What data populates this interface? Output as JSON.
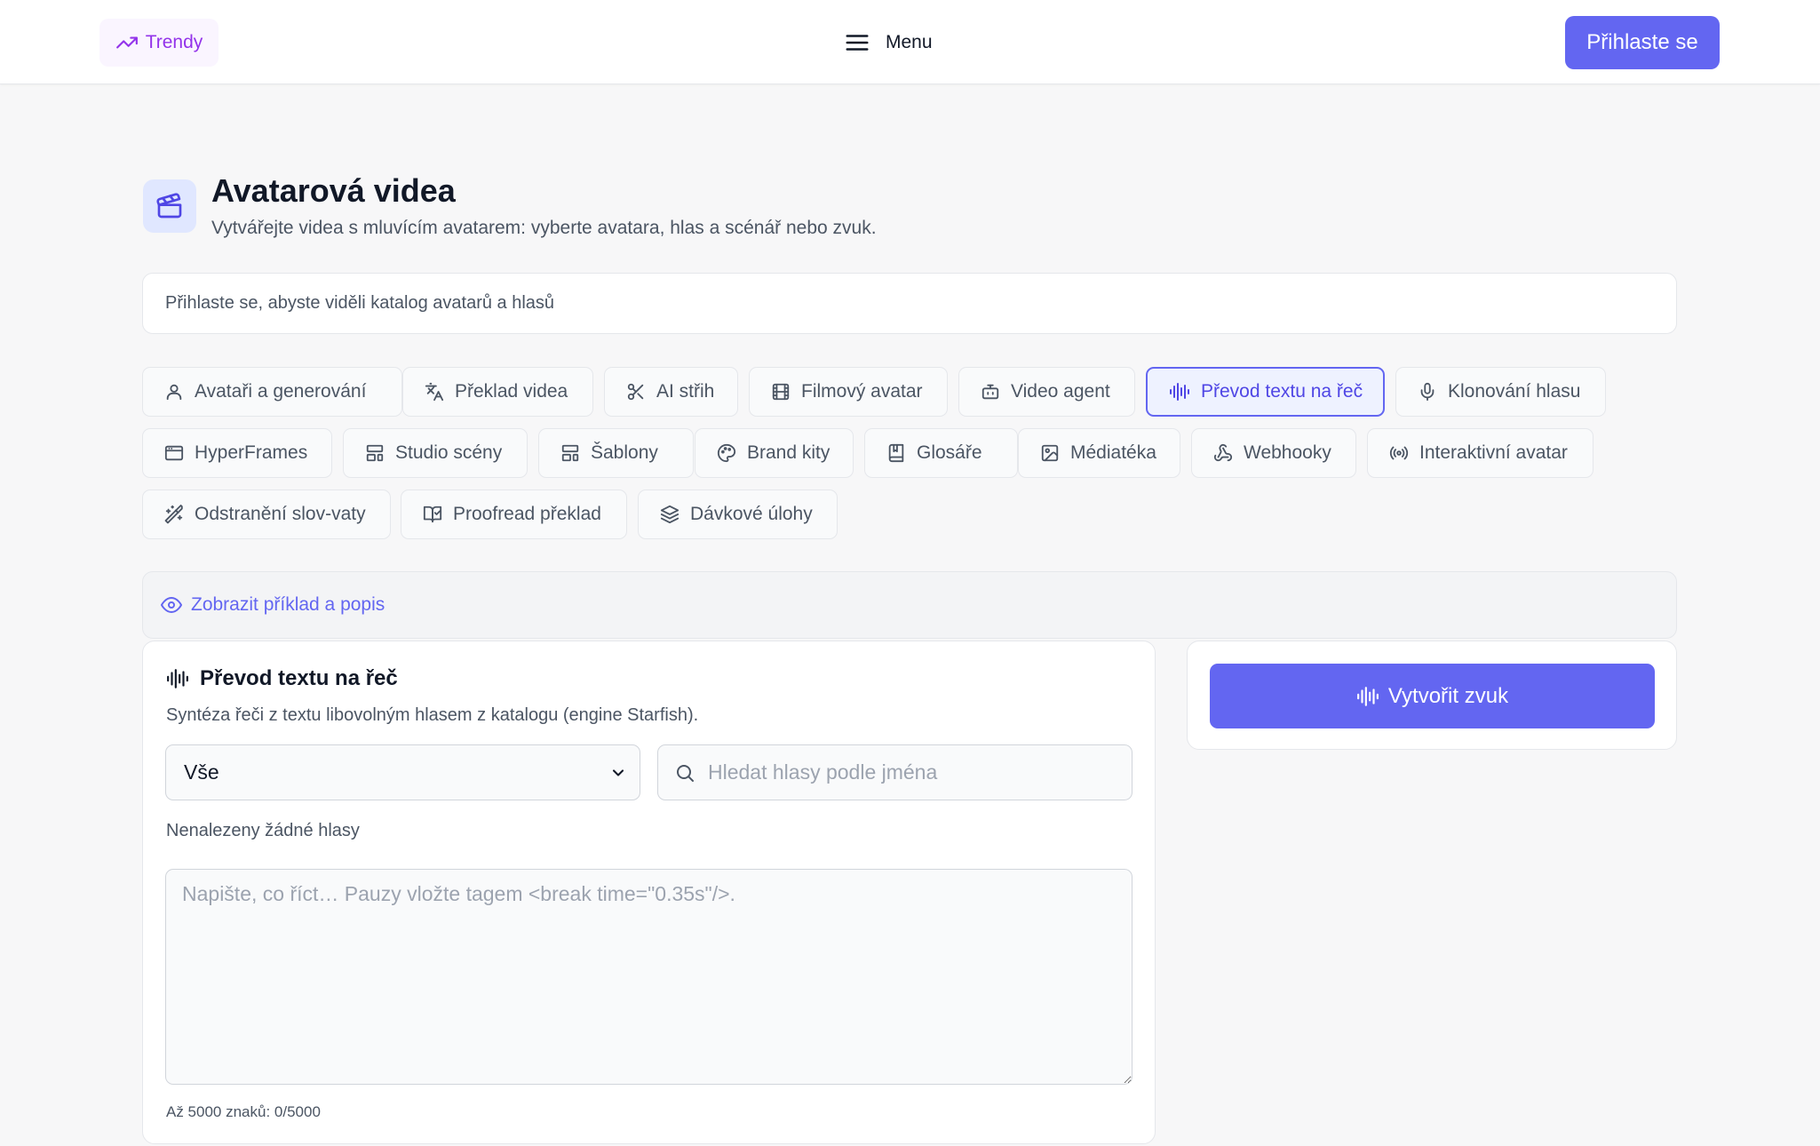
{
  "topbar": {
    "trend_label": "Trendy",
    "menu_label": "Menu",
    "login_label": "Přihlaste se"
  },
  "header": {
    "title": "Avatarová videa",
    "subtitle": "Vytvářejte videa s mluvícím avatarem: vyberte avatara, hlas a scénář nebo zvuk."
  },
  "info_bar": "Přihlaste se, abyste viděli katalog avatarů a hlasů",
  "tools": [
    {
      "label": "Avataři a generování",
      "icon": "user-icon"
    },
    {
      "label": "Překlad videa",
      "icon": "translate-icon"
    },
    {
      "label": "AI střih",
      "icon": "scissors-icon"
    },
    {
      "label": "Filmový avatar",
      "icon": "film-icon"
    },
    {
      "label": "Video agent",
      "icon": "bot-icon"
    },
    {
      "label": "Převod textu na řeč",
      "icon": "audio-waveform-icon",
      "active": true
    },
    {
      "label": "Klonování hlasu",
      "icon": "microphone-icon"
    },
    {
      "label": "HyperFrames",
      "icon": "browser-window-icon"
    },
    {
      "label": "Studio scény",
      "icon": "layout-icon"
    },
    {
      "label": "Šablony",
      "icon": "layout-template-icon"
    },
    {
      "label": "Brand kity",
      "icon": "palette-icon"
    },
    {
      "label": "Glosáře",
      "icon": "book-icon"
    },
    {
      "label": "Médiatéka",
      "icon": "image-icon"
    },
    {
      "label": "Webhooky",
      "icon": "webhook-icon"
    },
    {
      "label": "Interaktivní avatar",
      "icon": "radio-broadcast-icon"
    },
    {
      "label": "Odstranění slov-vaty",
      "icon": "magic-wand-icon"
    },
    {
      "label": "Proofread překlad",
      "icon": "book-check-icon"
    },
    {
      "label": "Dávkové úlohy",
      "icon": "layers-icon"
    }
  ],
  "example_toggle": "Zobrazit příklad a popis",
  "tts": {
    "title": "Převod textu na řeč",
    "description": "Syntéza řeči z textu libovolným hlasem z katalogu (engine Starfish).",
    "filter_value": "Vše",
    "search_placeholder": "Hledat hlasy podle jména",
    "no_voices": "Nenalezeny žádné hlasy",
    "text_placeholder": "Napište, co říct… Pauzy vložte tagem <break time=\"0.35s\"/>.",
    "char_count": "Až 5000 znaků: 0/5000"
  },
  "create_button": "Vytvořit zvuk",
  "colors": {
    "accent": "#6366f1",
    "accent_soft": "#eef2ff",
    "trend": "#9333ea"
  }
}
